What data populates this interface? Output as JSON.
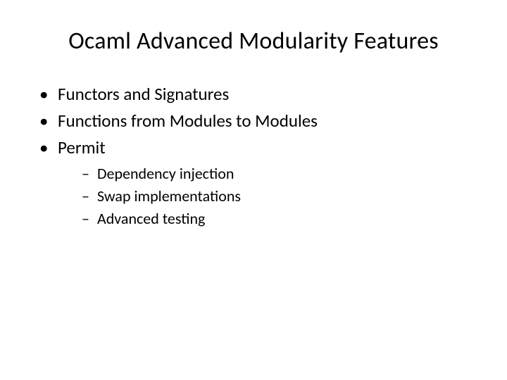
{
  "title": "Ocaml Advanced Modularity Features",
  "bullets": [
    {
      "text": "Functors and Signatures"
    },
    {
      "text": "Functions from Modules to Modules"
    },
    {
      "text": "Permit",
      "sub": [
        {
          "text": "Dependency injection"
        },
        {
          "text": "Swap implementations"
        },
        {
          "text": "Advanced testing"
        }
      ]
    }
  ]
}
